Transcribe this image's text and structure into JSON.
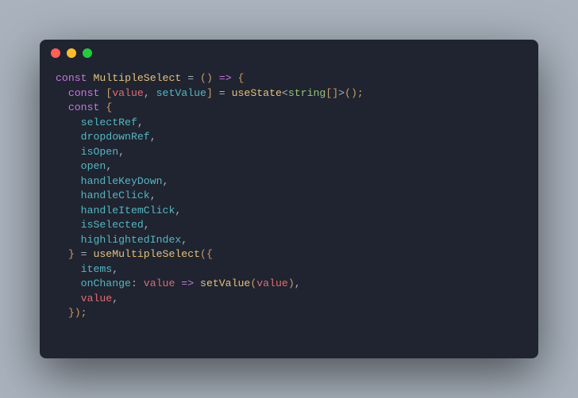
{
  "window": {
    "controls": [
      "close",
      "minimize",
      "zoom"
    ]
  },
  "code": {
    "l1": {
      "const": "const",
      "name": "MultipleSelect",
      "eq": " = ",
      "paren": "()",
      "arrow": " => ",
      "brace": "{"
    },
    "l2": {
      "const": "const",
      "lb": " [",
      "v": "value",
      "c1": ", ",
      "sv": "setValue",
      "rb": "] ",
      "eq": "= ",
      "hook": "useState",
      "lt": "<",
      "type": "string",
      "arr": "[]",
      "gt": ">",
      "call": "();"
    },
    "l3": {
      "const": "const",
      "brace": " {"
    },
    "l4": {
      "name": "selectRef",
      "c": ","
    },
    "l5": {
      "name": "dropdownRef",
      "c": ","
    },
    "l6": {
      "name": "isOpen",
      "c": ","
    },
    "l7": {
      "name": "open",
      "c": ","
    },
    "l8": {
      "name": "handleKeyDown",
      "c": ","
    },
    "l9": {
      "name": "handleClick",
      "c": ","
    },
    "l10": {
      "name": "handleItemClick",
      "c": ","
    },
    "l11": {
      "name": "isSelected",
      "c": ","
    },
    "l12": {
      "name": "highlightedIndex",
      "c": ","
    },
    "l13": {
      "brace": "} ",
      "eq": "= ",
      "hook": "useMultipleSelect",
      "open": "({"
    },
    "l14": {
      "name": "items",
      "c": ","
    },
    "l15": {
      "name": "onChange",
      "colon": ": ",
      "arg": "value",
      "arrow": " => ",
      "fn": "setValue",
      "op": "(",
      "argv": "value",
      "cp": ")",
      "c": ","
    },
    "l16": {
      "name": "value",
      "c": ","
    },
    "l17": {
      "close": "});"
    }
  }
}
